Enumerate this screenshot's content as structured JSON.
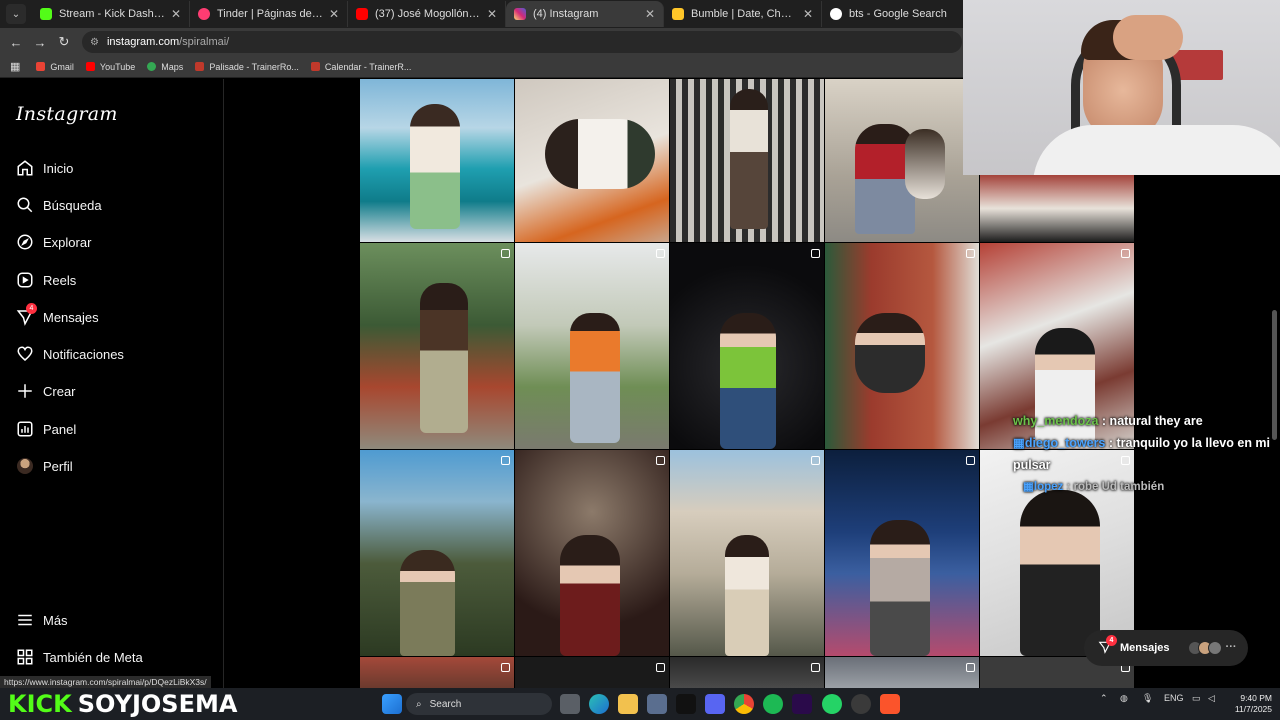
{
  "tabs": [
    {
      "title": "Stream - Kick Dashboard",
      "color": "#53fc18",
      "active": false
    },
    {
      "title": "Tinder | Páginas de citas",
      "color": "#fe3c72",
      "active": false
    },
    {
      "title": "(37) José Mogollón - YouTube",
      "color": "#ff0000",
      "active": false
    },
    {
      "title": "(4) Instagram",
      "color": "#d62976",
      "active": true
    },
    {
      "title": "Bumble | Date, Chat, Meet New",
      "color": "#ffc629",
      "active": false
    },
    {
      "title": "bts - Google Search",
      "color": "#ffffff",
      "active": false
    }
  ],
  "address": {
    "host": "instagram.com",
    "path": "/spiralmai/"
  },
  "bookmarks": [
    {
      "label": "Gmail",
      "color": "#ea4335"
    },
    {
      "label": "YouTube",
      "color": "#ff0000"
    },
    {
      "label": "Maps",
      "color": "#34a853"
    },
    {
      "label": "Palisade - TrainerRo...",
      "color": "#c0392b"
    },
    {
      "label": "Calendar - TrainerR...",
      "color": "#c0392b"
    }
  ],
  "sidebar": {
    "logo": "Instagram",
    "items": [
      {
        "label": "Inicio",
        "icon": "home-icon"
      },
      {
        "label": "Búsqueda",
        "icon": "search-icon"
      },
      {
        "label": "Explorar",
        "icon": "compass-icon"
      },
      {
        "label": "Reels",
        "icon": "reels-icon"
      },
      {
        "label": "Mensajes",
        "icon": "messenger-icon",
        "badge": "4"
      },
      {
        "label": "Notificaciones",
        "icon": "heart-icon"
      },
      {
        "label": "Crear",
        "icon": "plus-icon"
      },
      {
        "label": "Panel",
        "icon": "dashboard-icon"
      },
      {
        "label": "Perfil",
        "icon": "avatar"
      }
    ],
    "more": "Más",
    "meta": "También de Meta"
  },
  "chat": [
    {
      "user": "why_mendoza",
      "text": ": natural they are"
    },
    {
      "user": "diego_towers",
      "text": ": tranquilo yo la llevo en mi pulsar"
    },
    {
      "user": "lopez",
      "text": ": robe Ud también"
    }
  ],
  "messages_pill": {
    "label": "Mensajes",
    "badge": "4"
  },
  "status_url": "https://www.instagram.com/spiralmai/p/DQezLiBkX3s/",
  "kick_overlay": {
    "brand": "KICK",
    "channel": "SOYJOSEMA"
  },
  "taskbar": {
    "search": "Search",
    "lang": "ENG",
    "time": "9:40 PM",
    "date": "11/7/2025"
  }
}
